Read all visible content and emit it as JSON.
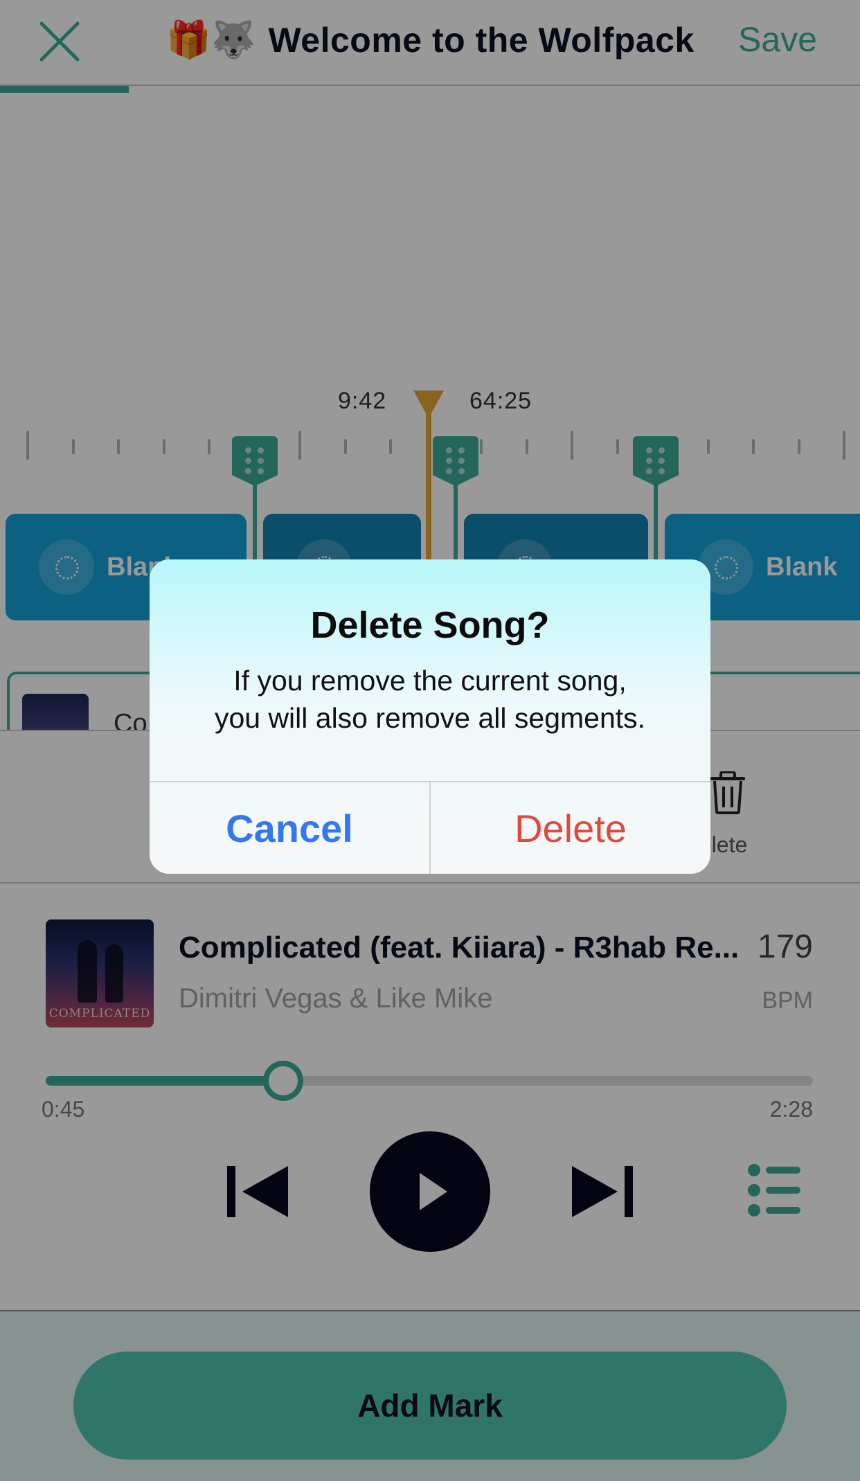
{
  "header": {
    "close_label": "close",
    "emoji": "🎁🐺",
    "title": "Welcome to the Wolfpack",
    "save_label": "Save",
    "progress_fraction": 0.15
  },
  "timeline": {
    "time_left": "9:42",
    "time_right": "64:25",
    "segments": [
      {
        "label": "Blank"
      },
      {
        "label": ""
      },
      {
        "label": ""
      },
      {
        "label": "Blank"
      }
    ],
    "song_row_text": "Co"
  },
  "toolbar": {
    "delete_label": "elete"
  },
  "now_playing": {
    "title": "Complicated (feat. Kiiara) - R3hab Re...",
    "artist": "Dimitri Vegas & Like Mike",
    "bpm": "179",
    "bpm_unit": "BPM",
    "album_text": "COMPLICATED",
    "elapsed": "0:45",
    "duration": "2:28",
    "progress_fraction": 0.31
  },
  "footer": {
    "add_mark_label": "Add Mark"
  },
  "dialog": {
    "title": "Delete Song?",
    "message_line1": "If you remove the current song,",
    "message_line2": "you will also remove all segments.",
    "cancel_label": "Cancel",
    "delete_label": "Delete"
  },
  "colors": {
    "accent": "#3daa98",
    "segment_blue": "#14a0d8",
    "playhead": "#e4a634",
    "cancel_blue": "#3478f0",
    "destructive_red": "#e2483d"
  }
}
